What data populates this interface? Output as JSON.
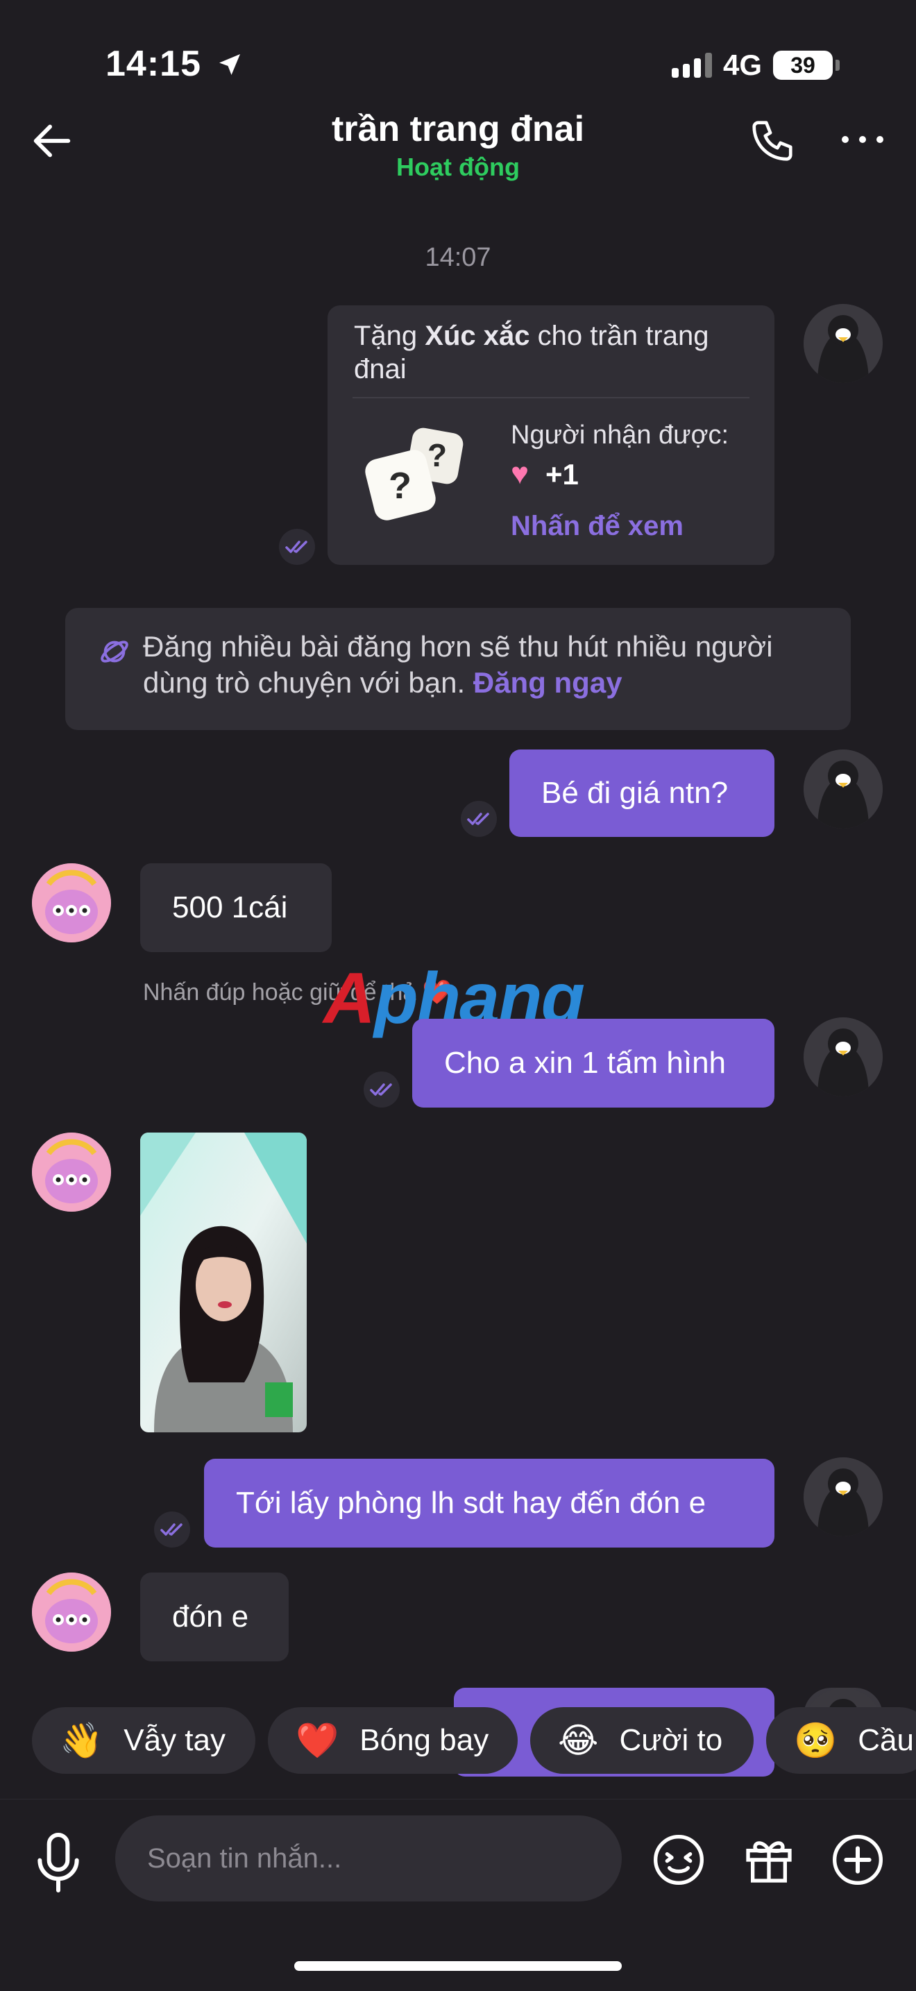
{
  "status_bar": {
    "time": "14:15",
    "network": "4G",
    "battery": "39"
  },
  "header": {
    "title": "trần trang đnai",
    "status": "Hoạt động"
  },
  "timestamp": "14:07",
  "gift_card": {
    "prefix": "Tặng ",
    "item": "Xúc xắc",
    "suffix": " cho trần trang đnai",
    "receiver_label": "Người nhận được:",
    "reward": "+1",
    "link": "Nhấn để xem"
  },
  "promo": {
    "text": "Đăng nhiều bài đăng hơn sẽ thu hút nhiều người dùng trò chuyện với bạn.",
    "link": "Đăng ngay"
  },
  "messages": [
    {
      "text": "Bé đi giá ntn?"
    },
    {
      "text": "500 1cái"
    },
    {
      "text": "Cho a xin 1 tấm hình"
    },
    {
      "text": "Tới lấy phòng lh sdt hay đến đón e"
    },
    {
      "text": "đón e"
    }
  ],
  "hint": "Nhấn đúp hoặc giữ để thả ❤️",
  "watermark": {
    "part1": "A",
    "part2": "phang"
  },
  "quick_reactions": [
    {
      "emoji": "👋",
      "label": "Vẫy tay"
    },
    {
      "emoji": "❤️",
      "label": "Bóng bay"
    },
    {
      "emoji": "😂",
      "label": "Cười to"
    },
    {
      "emoji": "🥺",
      "label": "Cầu"
    }
  ],
  "composer": {
    "placeholder": "Soạn tin nhắn..."
  },
  "colors": {
    "accent": "#7a5cd4",
    "online": "#2ecc5f",
    "background": "#1f1d22",
    "bubble_in": "#302e35"
  }
}
